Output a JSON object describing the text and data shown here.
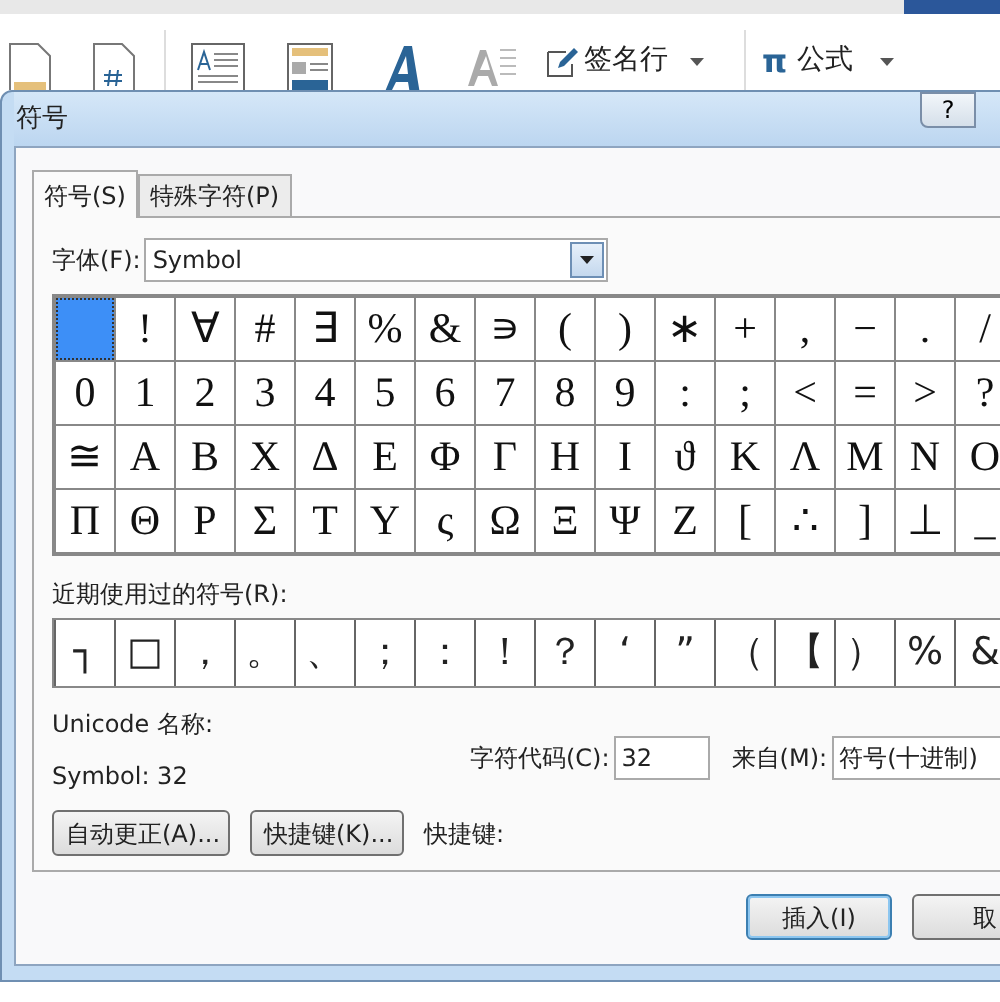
{
  "ribbon": {
    "signature_line": "签名行",
    "equation_icon": "π",
    "equation": "公式"
  },
  "dialog": {
    "title": "符号",
    "help": "?",
    "tabs": [
      {
        "label": "符号(S)",
        "selected": true
      },
      {
        "label": "特殊字符(P)",
        "selected": false
      }
    ],
    "font": {
      "label": "字体(F):",
      "value": "Symbol"
    },
    "symbol_grid": [
      [
        {
          "selected": true
        },
        {
          "char": "!",
          "selected": false
        },
        {
          "char": "∀",
          "selected": false
        },
        {
          "char": "#",
          "selected": false
        },
        {
          "char": "∃",
          "selected": false
        },
        {
          "char": "%",
          "selected": false
        },
        {
          "char": "&",
          "selected": false
        },
        {
          "char": "∍",
          "selected": false
        },
        {
          "char": "(",
          "selected": false
        },
        {
          "char": ")",
          "selected": false
        },
        {
          "char": "∗",
          "selected": false
        },
        {
          "char": "+",
          "selected": false
        },
        {
          "char": ",",
          "selected": false
        },
        {
          "char": "−",
          "selected": false
        },
        {
          "char": ".",
          "selected": false
        },
        {
          "char": "/",
          "selected": false
        }
      ],
      [
        {
          "char": "0",
          "selected": false
        },
        {
          "char": "1",
          "selected": false
        },
        {
          "char": "2",
          "selected": false
        },
        {
          "char": "3",
          "selected": false
        },
        {
          "char": "4",
          "selected": false
        },
        {
          "char": "5",
          "selected": false
        },
        {
          "char": "6",
          "selected": false
        },
        {
          "char": "7",
          "selected": false
        },
        {
          "char": "8",
          "selected": false
        },
        {
          "char": "9",
          "selected": false
        },
        {
          "char": ":",
          "selected": false
        },
        {
          "char": ";",
          "selected": false
        },
        {
          "char": "<",
          "selected": false
        },
        {
          "char": "=",
          "selected": false
        },
        {
          "char": ">",
          "selected": false
        },
        {
          "char": "?",
          "selected": false
        }
      ],
      [
        {
          "char": "≅",
          "selected": false
        },
        {
          "char": "Α",
          "selected": false
        },
        {
          "char": "Β",
          "selected": false
        },
        {
          "char": "Χ",
          "selected": false
        },
        {
          "char": "Δ",
          "selected": false
        },
        {
          "char": "Ε",
          "selected": false
        },
        {
          "char": "Φ",
          "selected": false
        },
        {
          "char": "Γ",
          "selected": false
        },
        {
          "char": "Η",
          "selected": false
        },
        {
          "char": "Ι",
          "selected": false
        },
        {
          "char": "ϑ",
          "selected": false
        },
        {
          "char": "Κ",
          "selected": false
        },
        {
          "char": "Λ",
          "selected": false
        },
        {
          "char": "Μ",
          "selected": false
        },
        {
          "char": "Ν",
          "selected": false
        },
        {
          "char": "Ο",
          "selected": false
        }
      ],
      [
        {
          "char": "Π",
          "selected": false
        },
        {
          "char": "Θ",
          "selected": false
        },
        {
          "char": "Ρ",
          "selected": false
        },
        {
          "char": "Σ",
          "selected": false
        },
        {
          "char": "Τ",
          "selected": false
        },
        {
          "char": "Υ",
          "selected": false
        },
        {
          "char": "ς",
          "selected": false
        },
        {
          "char": "Ω",
          "selected": false
        },
        {
          "char": "Ξ",
          "selected": false
        },
        {
          "char": "Ψ",
          "selected": false
        },
        {
          "char": "Ζ",
          "selected": false
        },
        {
          "char": "[",
          "selected": false
        },
        {
          "char": "∴",
          "selected": false
        },
        {
          "char": "]",
          "selected": false
        },
        {
          "char": "⊥",
          "selected": false
        },
        {
          "char": "_",
          "selected": false
        }
      ]
    ],
    "recent_label": "近期使用过的符号(R):",
    "recent_symbols": [
      "┐",
      "□",
      "，",
      "。",
      "、",
      "；",
      "：",
      "！",
      "？",
      "‘",
      "”",
      "（",
      "【",
      "）",
      "%",
      "&"
    ],
    "unicode_name_label": "Unicode 名称:",
    "symbol_info": "Symbol: 32",
    "char_code": {
      "label": "字符代码(C):",
      "value": "32"
    },
    "from": {
      "label": "来自(M):",
      "value": "符号(十进制)"
    },
    "autocorrect_button": "自动更正(A)...",
    "shortcut_key_button": "快捷键(K)...",
    "shortcut_label": "快捷键:",
    "insert_button": "插入(I)",
    "cancel_button": "取"
  }
}
